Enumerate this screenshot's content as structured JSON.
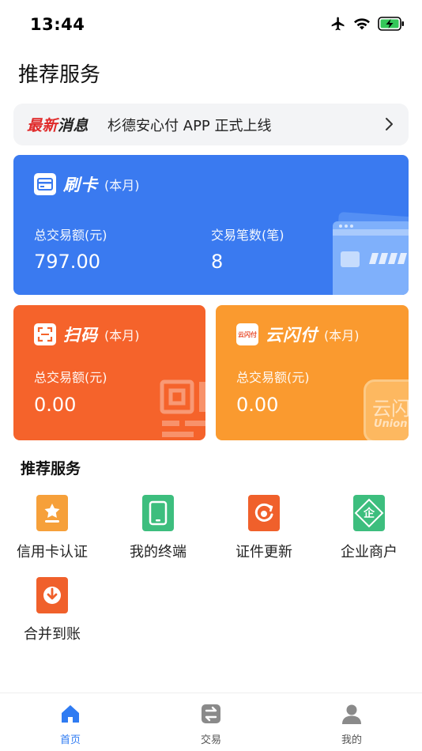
{
  "status_bar": {
    "time": "13:44"
  },
  "page_title": "推荐服务",
  "news": {
    "tag_part1": "最新",
    "tag_part2": "消息",
    "text": "杉德安心付 APP 正式上线"
  },
  "cards": {
    "swipe": {
      "title": "刷卡",
      "period": "(本月)",
      "amount_label": "总交易额(元)",
      "amount_value": "797.00",
      "count_label": "交易笔数(笔)",
      "count_value": "8",
      "color": "#3a7af0"
    },
    "scan": {
      "title": "扫码",
      "period": "(本月)",
      "amount_label": "总交易额(元)",
      "amount_value": "0.00",
      "color": "#f5632b"
    },
    "cloudpay": {
      "title": "云闪付",
      "period": "(本月)",
      "amount_label": "总交易额(元)",
      "amount_value": "0.00",
      "logo_text": "云闪付",
      "deco_text_line1": "云闪",
      "deco_text_line2": "Union",
      "color": "#fa9a2f"
    }
  },
  "services": {
    "title": "推荐服务",
    "items": [
      {
        "label": "信用卡认证",
        "icon": "credit-card-auth-icon",
        "color": "#f6a03a"
      },
      {
        "label": "我的终端",
        "icon": "terminal-icon",
        "color": "#3dbe7e"
      },
      {
        "label": "证件更新",
        "icon": "certificate-update-icon",
        "color": "#f0602b"
      },
      {
        "label": "企业商户",
        "icon": "enterprise-merchant-icon",
        "color": "#3dbe7e"
      },
      {
        "label": "合并到账",
        "icon": "merge-settlement-icon",
        "color": "#f0602b"
      }
    ],
    "enterprise_glyph": "企"
  },
  "tabbar": {
    "items": [
      {
        "label": "首页",
        "icon": "home-icon",
        "active": true
      },
      {
        "label": "交易",
        "icon": "transaction-icon",
        "active": false
      },
      {
        "label": "我的",
        "icon": "profile-icon",
        "active": false
      }
    ],
    "active_color": "#2f7bf2",
    "inactive_color": "#555555"
  }
}
